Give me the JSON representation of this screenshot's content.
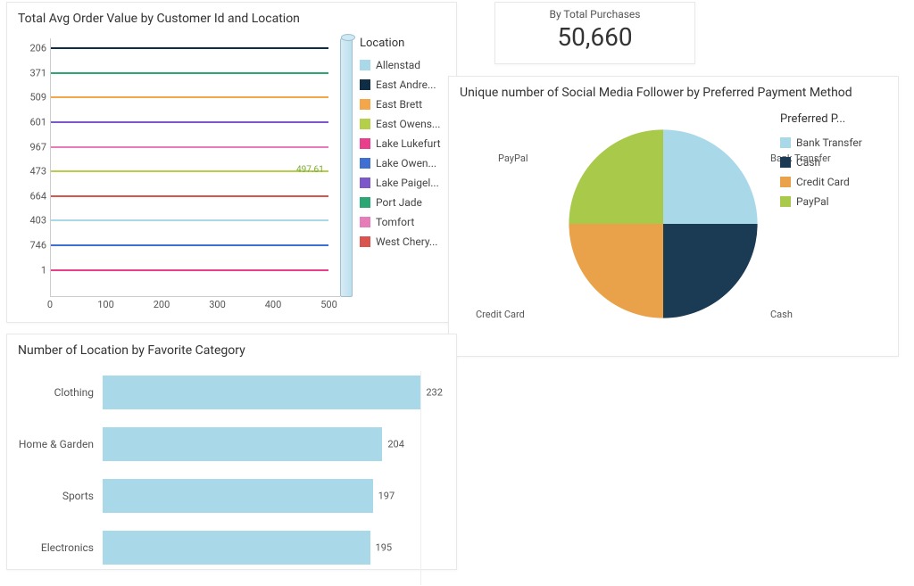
{
  "kpi": {
    "label": "By Total Purchases",
    "value": "50,660"
  },
  "lines_panel": {
    "title": "Total Avg Order Value by Customer Id and Location",
    "legend_title": "Location"
  },
  "pie_panel": {
    "title": "Unique number of Social Media Follower by Preferred Payment Method",
    "legend_title": "Preferred P..."
  },
  "hbars_panel": {
    "title": "Number of Location by Favorite Category"
  },
  "chart_data": [
    {
      "id": "lines",
      "type": "line",
      "xlabel": "",
      "ylabel": "",
      "xlim": [
        0,
        520
      ],
      "x_ticks": [
        0,
        100,
        200,
        300,
        400,
        500
      ],
      "y_categories": [
        "206",
        "371",
        "509",
        "601",
        "967",
        "473",
        "664",
        "403",
        "746",
        "1"
      ],
      "series": [
        {
          "name": "Allenstad",
          "color": "#a9d8e8",
          "y_index": 7,
          "value": 498
        },
        {
          "name": "East Andre...",
          "color": "#0f2d45",
          "y_index": 0,
          "value": 498
        },
        {
          "name": "East Brett",
          "color": "#f4a64b",
          "y_index": 2,
          "value": 498
        },
        {
          "name": "East Owens...",
          "color": "#b6cf4a",
          "y_index": 5,
          "value": 497.61,
          "highlight": true
        },
        {
          "name": "Lake Lukefurt",
          "color": "#e83e8c",
          "y_index": 9,
          "value": 498
        },
        {
          "name": "Lake Owen...",
          "color": "#3f6fd1",
          "y_index": 8,
          "value": 498
        },
        {
          "name": "Lake Paigel...",
          "color": "#7b57c9",
          "y_index": 3,
          "value": 498
        },
        {
          "name": "Port Jade",
          "color": "#2aa775",
          "y_index": 1,
          "value": 498
        },
        {
          "name": "Tomfort",
          "color": "#e77db8",
          "y_index": 4,
          "value": 498
        },
        {
          "name": "West Chery...",
          "color": "#d9534f",
          "y_index": 6,
          "value": 498
        }
      ]
    },
    {
      "id": "pie",
      "type": "pie",
      "slices": [
        {
          "name": "Bank Transfer",
          "value": 25,
          "color": "#a9d8e8"
        },
        {
          "name": "Cash",
          "value": 25,
          "color": "#1b3a53"
        },
        {
          "name": "Credit Card",
          "value": 25,
          "color": "#e9a24a"
        },
        {
          "name": "PayPal",
          "value": 25,
          "color": "#a8c94a"
        }
      ]
    },
    {
      "id": "hbars",
      "type": "bar",
      "orientation": "horizontal",
      "max": 250,
      "grid_at": 232,
      "categories": [
        "Clothing",
        "Home & Garden",
        "Sports",
        "Electronics"
      ],
      "values": [
        232,
        204,
        197,
        195
      ]
    }
  ]
}
